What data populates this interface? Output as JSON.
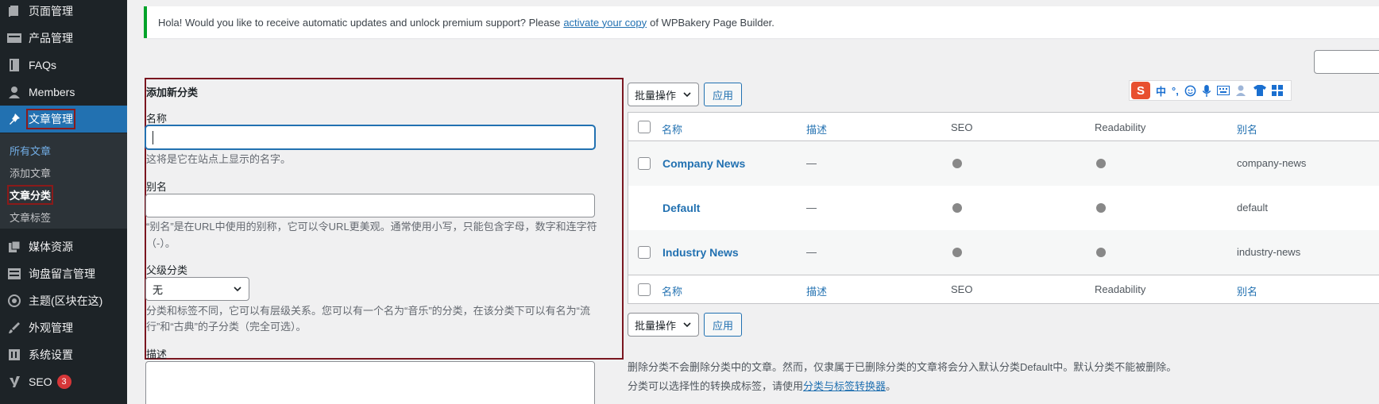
{
  "sidebar": {
    "items": [
      {
        "label": "页面管理",
        "icon": "pages-icon"
      },
      {
        "label": "产品管理",
        "icon": "products-icon"
      },
      {
        "label": "FAQs",
        "icon": "book-icon"
      },
      {
        "label": "Members",
        "icon": "user-icon"
      },
      {
        "label": "文章管理",
        "icon": "pin-icon"
      },
      {
        "label": "媒体资源",
        "icon": "media-icon"
      },
      {
        "label": "询盘留言管理",
        "icon": "form-icon"
      },
      {
        "label": "主题(区块在这)",
        "icon": "theme-icon"
      },
      {
        "label": "外观管理",
        "icon": "brush-icon"
      },
      {
        "label": "系统设置",
        "icon": "settings-icon"
      },
      {
        "label": "SEO",
        "icon": "yoast-icon",
        "badge": "3"
      }
    ],
    "submenu": [
      "所有文章",
      "添加文章",
      "文章分类",
      "文章标签"
    ]
  },
  "notice": {
    "before": "Hola! Would you like to receive automatic updates and unlock premium support? Please",
    "link": "activate your copy",
    "after": "of WPBakery Page Builder."
  },
  "form": {
    "title": "添加新分类",
    "name_label": "名称",
    "name_hint": "这将是它在站点上显示的名字。",
    "slug_label": "别名",
    "slug_hint_1": "“别名”是在URL中使用的别称，它可以令URL更美观。通常使用小写，只能包含字母，数字和连字符",
    "slug_hint_2": "（-）。",
    "parent_label": "父级分类",
    "parent_value": "无",
    "parent_hint_1": "分类和标签不同，它可以有层级关系。您可以有一个名为“音乐”的分类，在该分类下可以有名为“流",
    "parent_hint_2": "行”和“古典”的子分类（完全可选）。",
    "desc_label": "描述"
  },
  "actions": {
    "bulk": "批量操作",
    "apply": "应用"
  },
  "ime": {
    "zh": "中",
    "punct": "°,"
  },
  "table": {
    "columns": [
      "名称",
      "描述",
      "SEO",
      "Readability",
      "别名"
    ],
    "rows": [
      {
        "name": "Company News",
        "desc": "—",
        "slug": "company-news"
      },
      {
        "name": "Default",
        "desc": "—",
        "slug": "default"
      },
      {
        "name": "Industry News",
        "desc": "—",
        "slug": "industry-news"
      }
    ]
  },
  "footer": {
    "note1": "删除分类不会删除分类中的文章。然而，仅隶属于已删除分类的文章将会分入默认分类Default中。默认分类不能被删除。",
    "note2_before": "分类可以选择性的转换成标签，请使用",
    "note2_link": "分类与标签转换器",
    "note2_after": "。"
  },
  "colors": {
    "accent": "#2271b1",
    "sidebar": "#1d2327",
    "highlight": "#7a1620",
    "notice": "#00a32a"
  }
}
